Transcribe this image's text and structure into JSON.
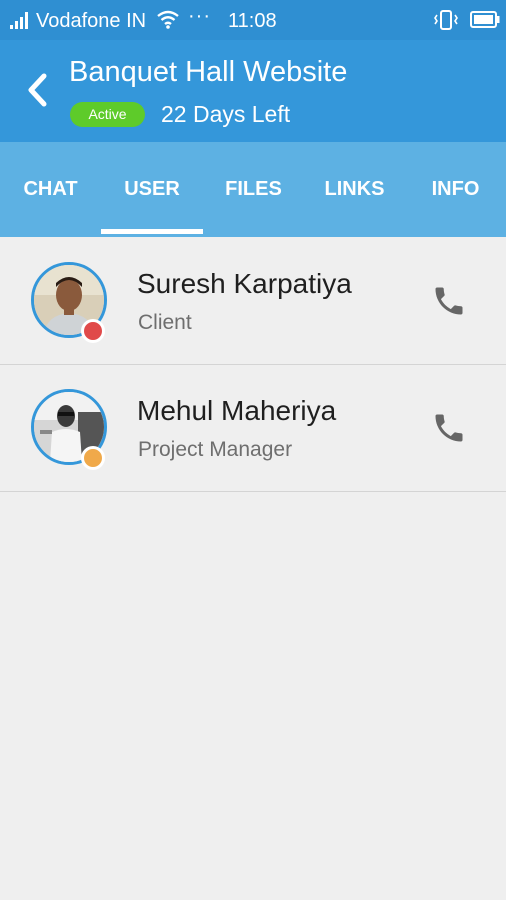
{
  "statusbar": {
    "carrier": "Vodafone IN",
    "dots": "···",
    "time": "11:08",
    "icons": [
      "signal-icon",
      "wifi-icon",
      "vibrate-icon",
      "battery-icon"
    ]
  },
  "header": {
    "title": "Banquet Hall Website",
    "status": "Active",
    "days_left": "22 Days Left",
    "back_icon": "chevron-left-icon"
  },
  "tabs": [
    {
      "label": "CHAT"
    },
    {
      "label": "USER",
      "active": true
    },
    {
      "label": "FILES"
    },
    {
      "label": "LINKS"
    },
    {
      "label": "INFO"
    }
  ],
  "users": [
    {
      "name": "Suresh Karpatiya",
      "role": "Client",
      "presence_color": "#e04a4a",
      "action_icon": "phone-icon"
    },
    {
      "name": "Mehul Maheriya",
      "role": "Project Manager",
      "presence_color": "#f0a94a",
      "action_icon": "phone-icon"
    }
  ],
  "colors": {
    "statusbar": "#2f8fd2",
    "header": "#3497da",
    "tabs": "#5db1e3",
    "active_pill": "#5ecb2a",
    "background": "#efefef"
  }
}
